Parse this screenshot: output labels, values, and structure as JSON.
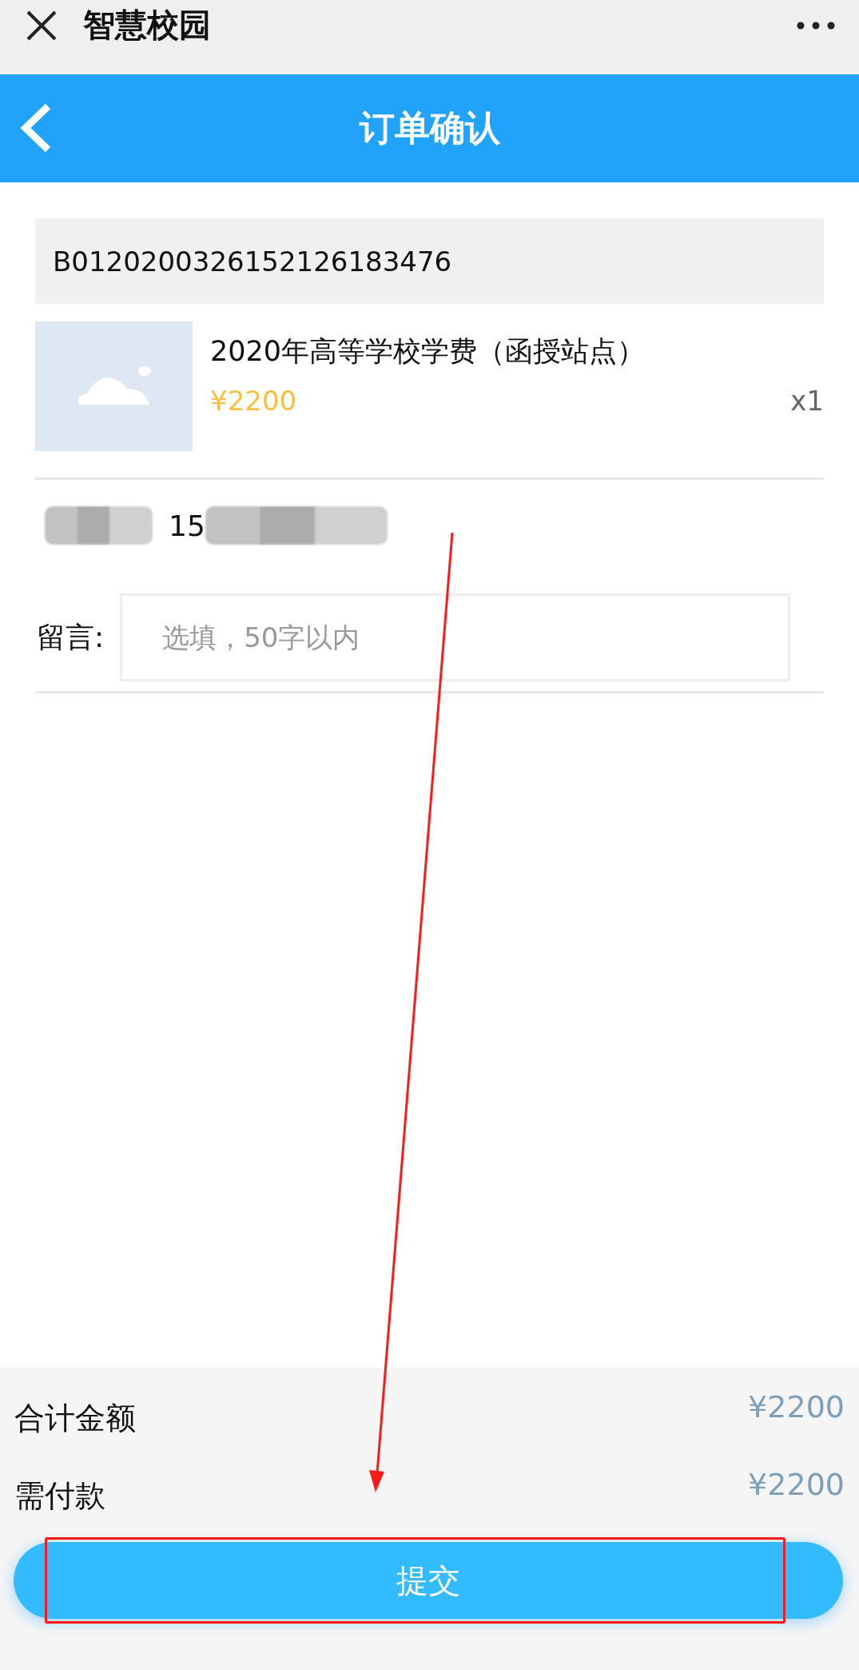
{
  "top_bar": {
    "title": "智慧校园"
  },
  "header": {
    "title": "订单确认"
  },
  "order_number": "B0120200326152126183476",
  "product": {
    "title": "2020年高等学校学费（函授站点）",
    "price": "¥2200",
    "quantity": "x1"
  },
  "contact": {
    "phone_visible": "15"
  },
  "message": {
    "label": "留言:",
    "placeholder": "选填，50字以内"
  },
  "summary": [
    {
      "label": "合计金额",
      "amount": "¥2200"
    },
    {
      "label": "需付款",
      "amount": "¥2200"
    }
  ],
  "submit_button": {
    "label": "提交"
  }
}
